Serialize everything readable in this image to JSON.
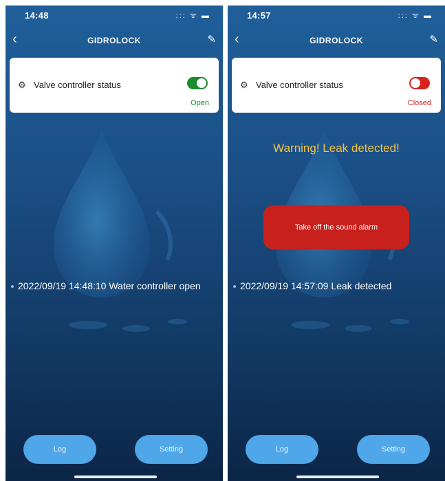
{
  "screens": [
    {
      "status_time": "14:48",
      "status_icons": "::: ᯤ ▬",
      "nav": {
        "back": "‹",
        "title": "GIDROLOCK",
        "edit": "✎"
      },
      "card": {
        "label": "Valve controller status",
        "state": "Open",
        "toggle": "on",
        "state_color": "#1b8c2b"
      },
      "event": "2022/09/19 14:48:10 Water controller open",
      "buttons": {
        "log": "Log",
        "setting": "Setting"
      }
    },
    {
      "status_time": "14:57",
      "status_icons": "::: ᯤ ▬",
      "nav": {
        "back": "‹",
        "title": "GIDROLOCK",
        "edit": "✎"
      },
      "card": {
        "label": "Valve controller status",
        "state": "Closed",
        "toggle": "off",
        "state_color": "#d8231f"
      },
      "warning": "Warning! Leak detected!",
      "alarm_button": "Take off the sound alarm",
      "event": "2022/09/19 14:57:09 Leak detected",
      "buttons": {
        "log": "Log",
        "setting": "Setting"
      }
    }
  ],
  "colors": {
    "warning": "#f5c242",
    "alarm": "#c8201c",
    "button": "#4fa6e8"
  }
}
